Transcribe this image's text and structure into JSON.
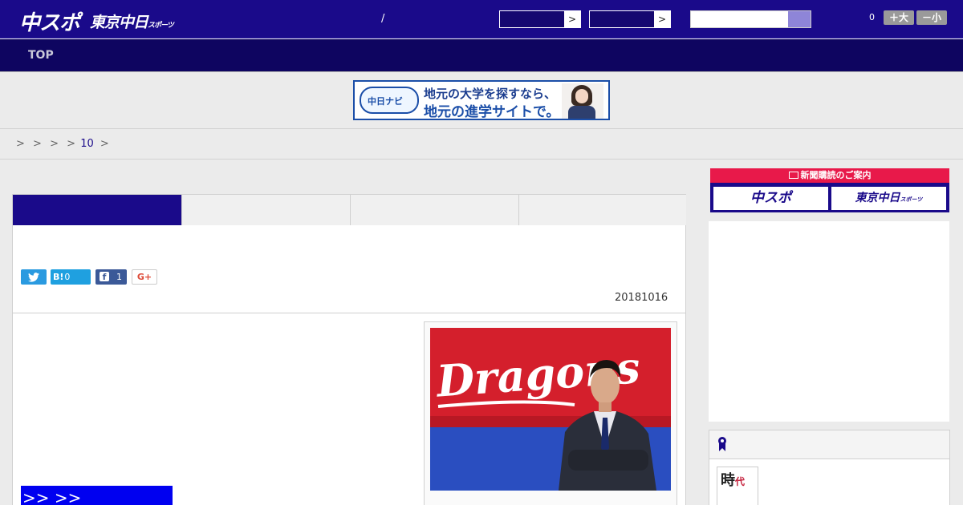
{
  "header": {
    "logo_main": "中スポ",
    "logo_sub": "東京中日",
    "logo_sub_small": "スポーツ",
    "slash": "/",
    "select_arrow": ">",
    "counter": "0",
    "font_larger": "＋大",
    "font_smaller": "－小"
  },
  "nav": {
    "top_label": "TOP"
  },
  "banner": {
    "badge_text": "中日ナビ",
    "line1": "地元の大学を探すなら、",
    "line2": "地元の進学サイトで。"
  },
  "breadcrumb": {
    "separators": [
      ">",
      ">",
      ">",
      ">"
    ],
    "link": "10",
    "tail": ">"
  },
  "share": {
    "twitter_icon": "twitter-bird-icon",
    "hatena_label": "B!",
    "hatena_count": "0",
    "facebook_label": "f",
    "facebook_count": "1",
    "gplus_label": "G+"
  },
  "article": {
    "date": "20181016",
    "more_button": ">> >>"
  },
  "photo": {
    "sign_text": "Dragons"
  },
  "sidebar": {
    "subscribe_strip": "新聞購読のご案内",
    "subscribe_left": "中スポ",
    "subscribe_right": "東京中日",
    "subscribe_right_small": "スポーツ",
    "thumb_text1": "時",
    "thumb_text2": "代"
  },
  "colors": {
    "header_bg": "#1a0a8a",
    "nav_bg": "#0e0560",
    "accent_red": "#e8194a",
    "button_blue": "#0000f0"
  }
}
